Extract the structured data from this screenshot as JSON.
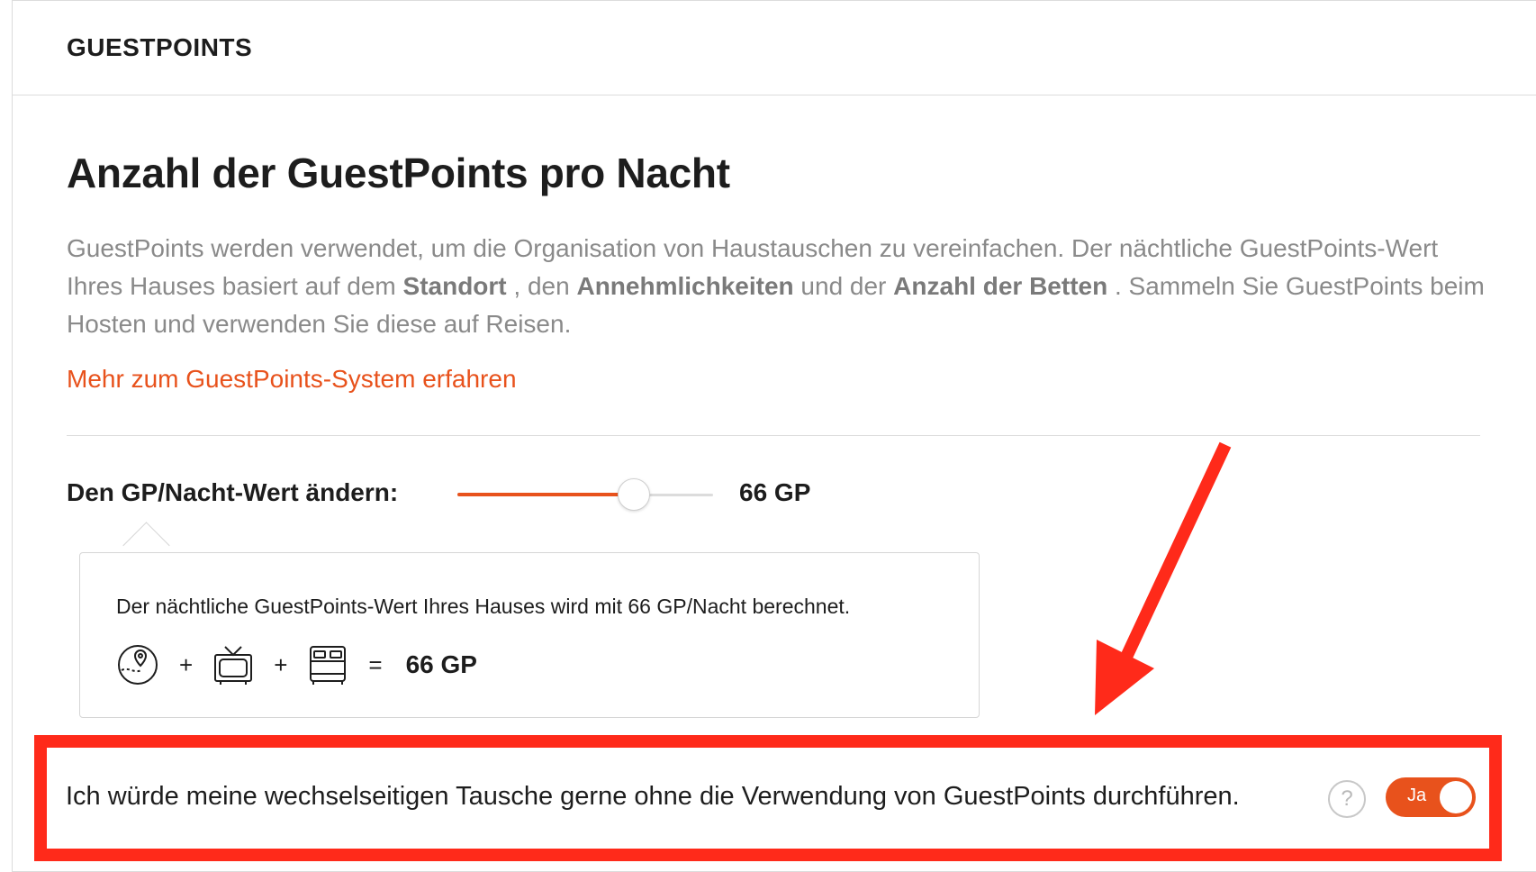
{
  "header": {
    "title": "GUESTPOINTS"
  },
  "main": {
    "heading": "Anzahl der GuestPoints pro Nacht",
    "description": {
      "p1": "GuestPoints werden verwendet, um die Organisation von Haustauschen zu vereinfachen. Der nächtliche GuestPoints-Wert Ihres Hauses basiert auf dem ",
      "b1": "Standort",
      "p2": " , den ",
      "b2": "Annehmlichkeiten",
      "p3": " und der ",
      "b3": "Anzahl der Betten",
      "p4": " . Sammeln Sie GuestPoints beim Hosten und verwenden Sie diese auf Reisen."
    },
    "more_link": "Mehr zum GuestPoints-System erfahren"
  },
  "slider": {
    "label": "Den GP/Nacht-Wert ändern:",
    "value_label": "66 GP",
    "fill_fraction": 0.69
  },
  "infobox": {
    "text": "Der nächtliche GuestPoints-Wert Ihres Hauses wird mit 66 GP/Nacht berechnet.",
    "formula": {
      "icons": [
        "location-map-icon",
        "tv-icon",
        "bed-icon"
      ],
      "plus": "+",
      "equals": "=",
      "result": "66 GP"
    }
  },
  "toggle_row": {
    "text": "Ich würde meine wechselseitigen Tausche gerne ohne die Verwendung von GuestPoints durchführen.",
    "help_icon": "?",
    "toggle_label": "Ja",
    "toggle_on": true
  },
  "colors": {
    "accent": "#e8521c",
    "annotation": "#ff2a1a"
  }
}
